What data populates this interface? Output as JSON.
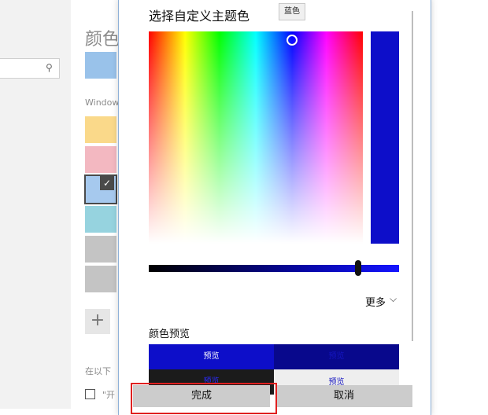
{
  "background": {
    "title": "颜色",
    "windows_label": "Window",
    "text1": "在以下",
    "text2": "\"开"
  },
  "dialog": {
    "title": "选择自定义主题色",
    "tooltip": "蓝色",
    "more_label": "更多",
    "preview_label": "颜色预览",
    "preview_text_a": "预览",
    "preview_text_b": "预览",
    "preview_text_c": "预览",
    "preview_text_d": "预览",
    "done_label": "完成",
    "cancel_label": "取消",
    "selected_color": "#0d0ec9"
  },
  "colors": {
    "accent_swatch": "#99c2ea",
    "swatch_yellow": "#fad98a",
    "swatch_pink": "#f3b8c1",
    "swatch_blue": "#a6c9ee",
    "swatch_teal": "#96d3df",
    "swatch_gray1": "#c4c4c4",
    "swatch_gray2": "#c4c4c4",
    "highlight": "#e02020"
  },
  "icons": {
    "search": "search-icon",
    "check": "check-icon",
    "add": "plus-icon",
    "chevron": "chevron-down-icon"
  }
}
